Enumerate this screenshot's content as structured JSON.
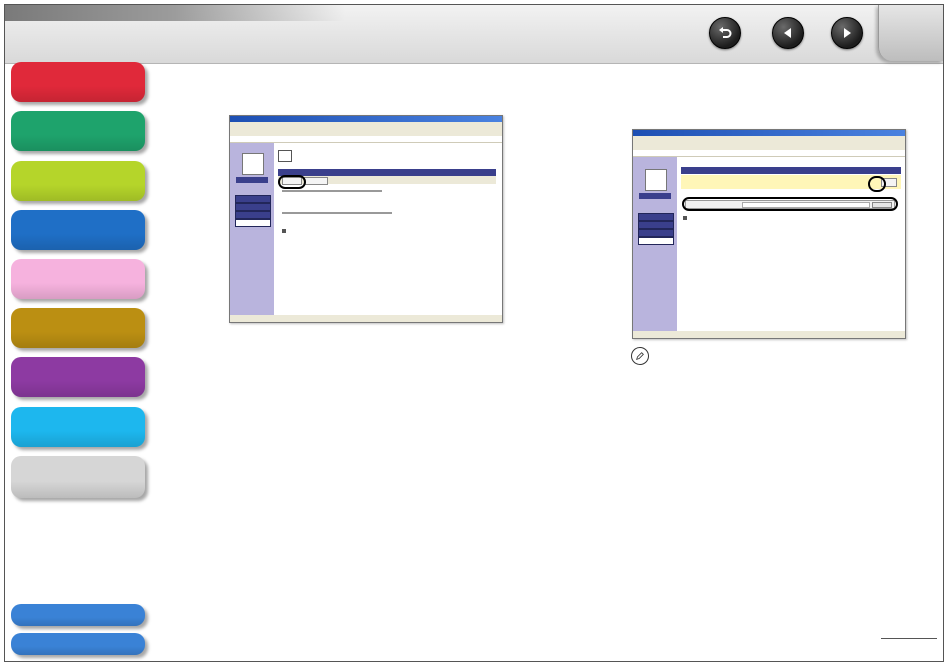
{
  "header": {
    "back_icon": "return-arrow-icon",
    "prev_icon": "triangle-left-icon",
    "next_icon": "triangle-right-icon"
  },
  "sidebar": {
    "tabs": [
      {
        "color": "#e0293a"
      },
      {
        "color": "#1ea36c"
      },
      {
        "color": "#b5d52a"
      },
      {
        "color": "#1f6fc6"
      },
      {
        "color": "#f6b2de"
      },
      {
        "color": "#bb8f12"
      },
      {
        "color": "#8d3aa2"
      },
      {
        "color": "#1db7ee"
      },
      {
        "color": "#d6d6d6"
      },
      {
        "color": "#3a82d6"
      },
      {
        "color": "#3a82d6"
      }
    ]
  },
  "note_icon": "pencil-note-icon"
}
